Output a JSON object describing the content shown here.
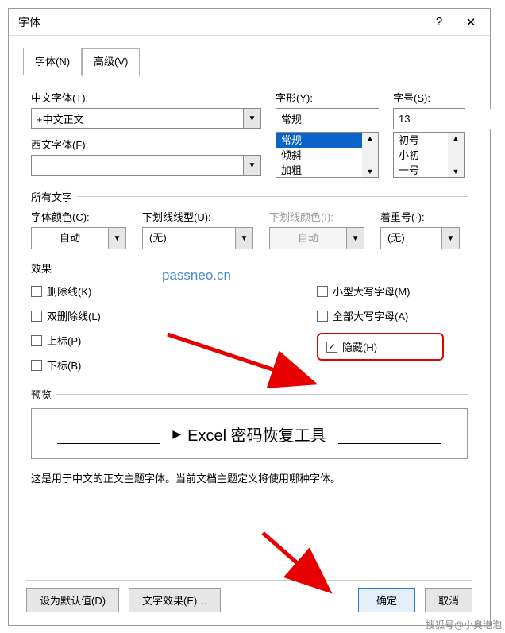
{
  "titlebar": {
    "title": "字体",
    "help": "?",
    "close": "✕"
  },
  "tabs": {
    "font": "字体(N)",
    "advanced": "高级(V)"
  },
  "labels": {
    "cn_font": "中文字体(T):",
    "west_font": "西文字体(F):",
    "style": "字形(Y):",
    "size": "字号(S):",
    "all_text": "所有文字",
    "font_color": "字体颜色(C):",
    "underline": "下划线线型(U):",
    "underline_color": "下划线颜色(I):",
    "emphasis": "着重号(·):",
    "effects": "效果",
    "preview": "预览"
  },
  "values": {
    "cn_font": "+中文正文",
    "west_font": "",
    "style": "常规",
    "size": "13",
    "font_color": "自动",
    "underline": "(无)",
    "underline_color": "自动",
    "emphasis": "(无)"
  },
  "style_options": [
    "常规",
    "倾斜",
    "加粗"
  ],
  "size_options": [
    "初号",
    "小初",
    "一号"
  ],
  "effects_left": {
    "strike": "删除线(K)",
    "dstrike": "双删除线(L)",
    "sup": "上标(P)",
    "sub": "下标(B)"
  },
  "effects_right": {
    "smallcaps": "小型大写字母(M)",
    "allcaps": "全部大写字母(A)",
    "hidden": "隐藏(H)"
  },
  "preview_text": "Excel 密码恢复工具",
  "desc": "这是用于中文的正文主题字体。当前文档主题定义将使用哪种字体。",
  "footer": {
    "default": "设为默认值(D)",
    "text_effects": "文字效果(E)…",
    "ok": "确定",
    "cancel": "取消"
  },
  "watermark": "passneo.cn",
  "credit": "搜狐号@小奥泡泡"
}
